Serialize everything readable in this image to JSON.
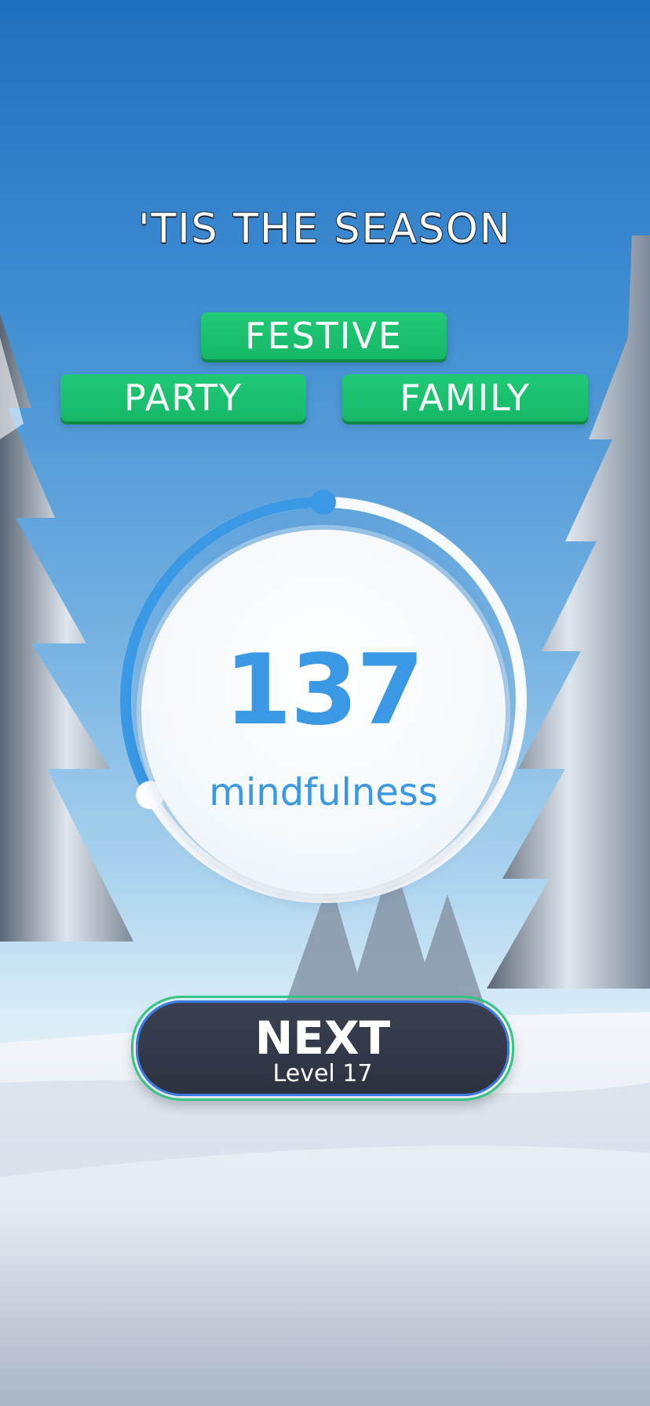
{
  "level_title": "'TIS THE SEASON",
  "found_words": [
    "FESTIVE",
    "PARTY",
    "FAMILY"
  ],
  "score": {
    "value": "137",
    "label": "mindfulness",
    "progress_fraction": 0.33
  },
  "next_button": {
    "label": "NEXT",
    "sublabel": "Level 17"
  },
  "colors": {
    "word_tile": "#1cc06f",
    "score_text": "#3a98e4",
    "ring_progress": "#3a98e4",
    "button_bg": "#343a4a",
    "button_border_green": "#34c483",
    "button_border_blue": "#3d7be0"
  },
  "background": {
    "scene": "snowy-forest-icon"
  }
}
